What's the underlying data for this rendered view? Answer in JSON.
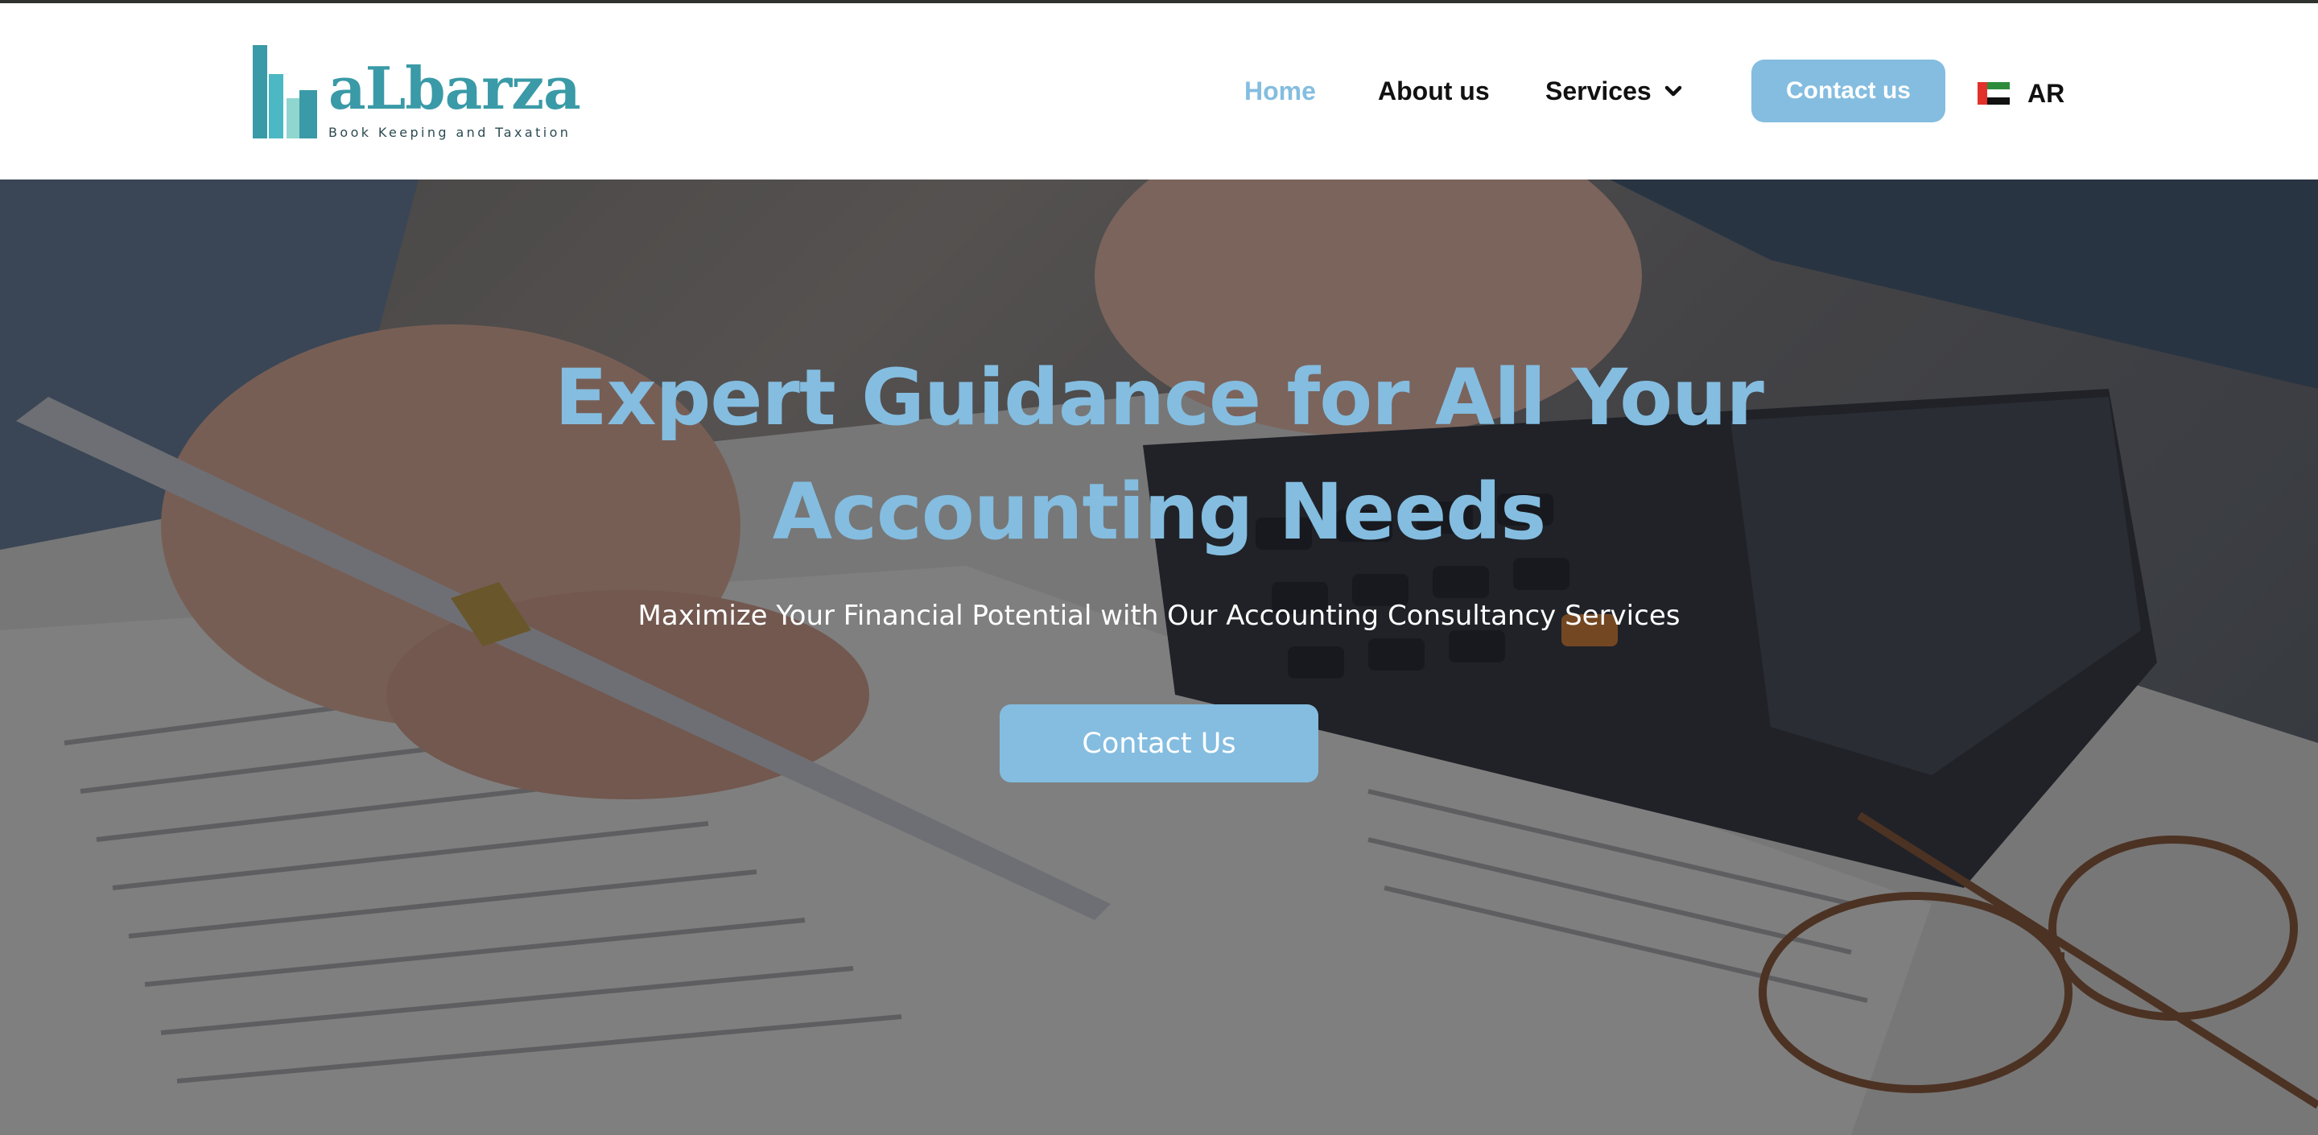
{
  "brand": {
    "name": "aLbarza",
    "tagline": "Book Keeping and Taxation",
    "color": "#3a9aa7"
  },
  "nav": {
    "items": [
      {
        "label": "Home",
        "active": true
      },
      {
        "label": "About us",
        "active": false
      },
      {
        "label": "Services",
        "active": false
      }
    ],
    "services_dropdown_icon": "chevron-down-icon",
    "contact_label": "Contact us",
    "language": {
      "label": "AR",
      "flag": "uae-flag-icon"
    }
  },
  "hero": {
    "title": "Expert Guidance for All Your Accounting Needs",
    "subtitle": "Maximize Your Financial Potential with Our Accounting Consultancy Services",
    "cta_label": "Contact Us"
  },
  "colors": {
    "accent": "#84bde0",
    "text_dark": "#111111",
    "white": "#ffffff"
  }
}
